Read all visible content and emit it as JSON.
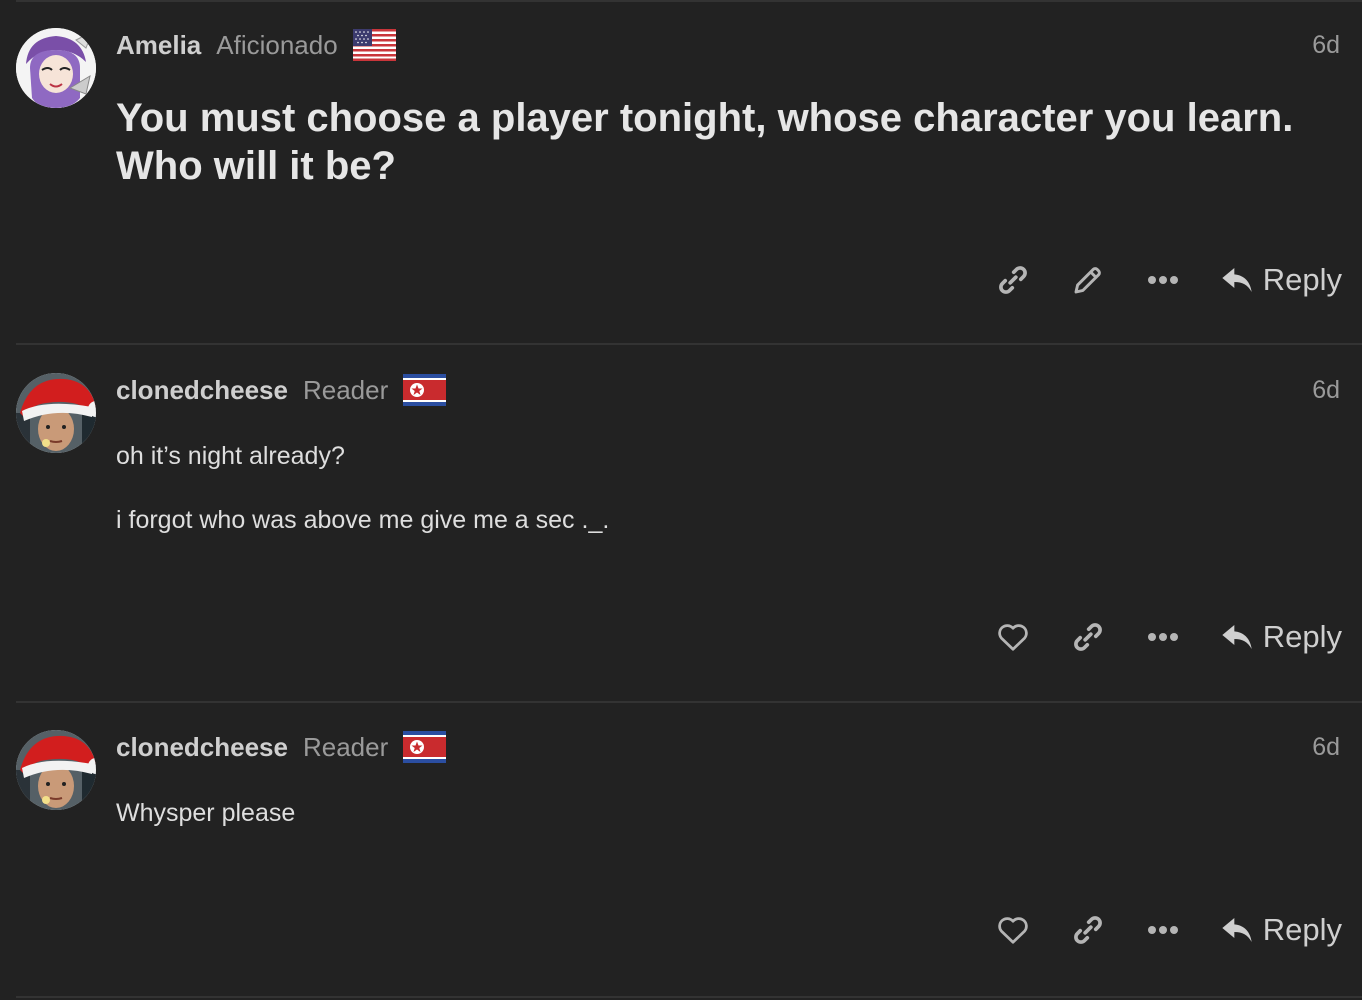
{
  "posts": [
    {
      "username": "Amelia",
      "user_title": "Aficionado",
      "flag": "us-flag",
      "date": "6d",
      "content": [
        "You must choose a player tonight, whose character you learn. Who will it be?"
      ],
      "actions": [
        "link-icon",
        "edit-icon",
        "more-icon"
      ],
      "reply_label": "Reply"
    },
    {
      "username": "clonedcheese",
      "user_title": "Reader",
      "flag": "north-korea-flag",
      "date": "6d",
      "content": [
        "oh it’s night already?",
        "i forgot who was above me give me a sec ._."
      ],
      "actions": [
        "heart-icon",
        "link-icon",
        "more-icon"
      ],
      "reply_label": "Reply"
    },
    {
      "username": "clonedcheese",
      "user_title": "Reader",
      "flag": "north-korea-flag",
      "date": "6d",
      "content": [
        "Whysper please"
      ],
      "actions": [
        "heart-icon",
        "link-icon",
        "more-icon"
      ],
      "reply_label": "Reply"
    }
  ],
  "colors": {
    "background": "#222222",
    "divider": "#333333",
    "text": "#dcdcdc",
    "muted": "#9a9a9a"
  }
}
